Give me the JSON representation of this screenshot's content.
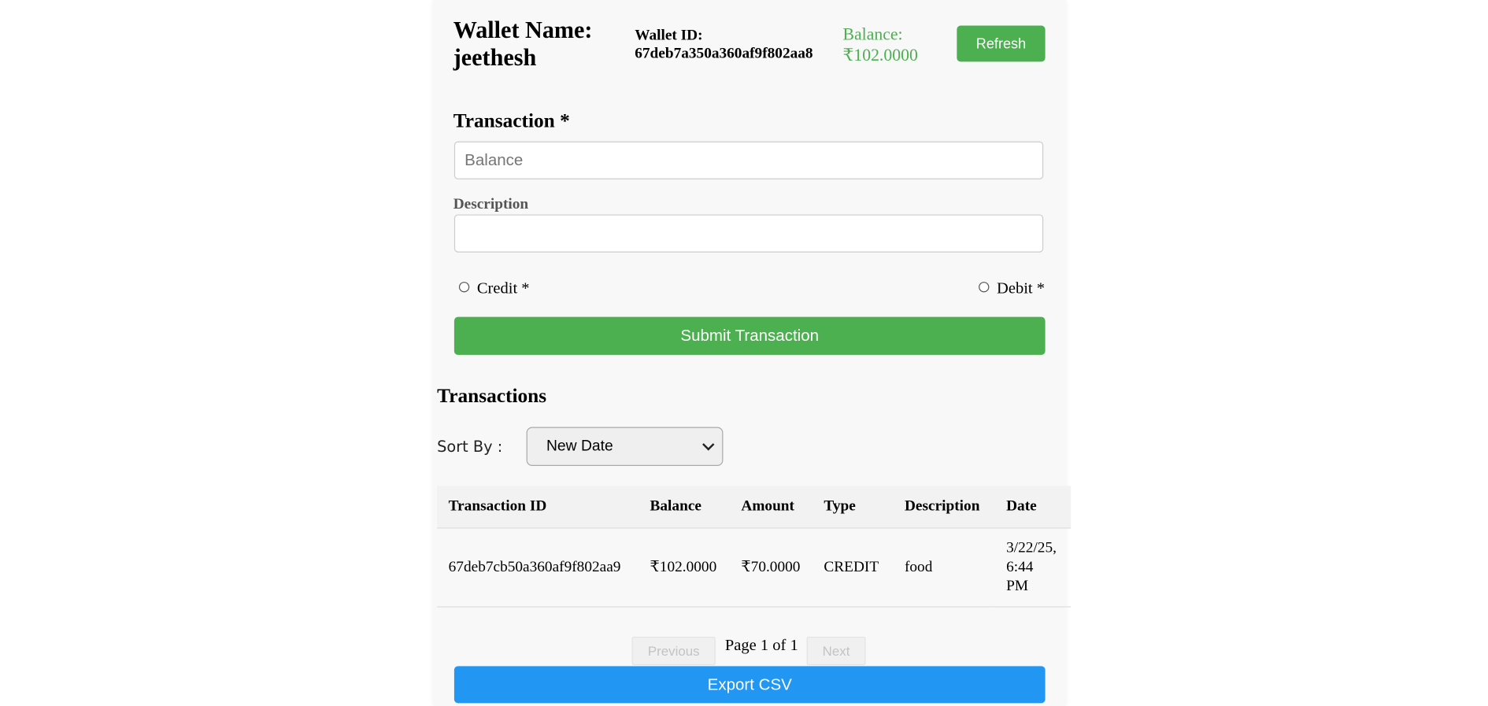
{
  "wallet": {
    "name_line1": "Wallet Name:",
    "name_line2": "jeethesh",
    "id_label": "Wallet ID:",
    "id_value": "67deb7a350a360af9f802aa8",
    "balance_label": "Balance:",
    "balance_value": "₹102.0000",
    "refresh_label": "Refresh"
  },
  "form": {
    "transaction_label": "Transaction *",
    "amount_placeholder": "Balance",
    "description_label": "Description",
    "description_value": "",
    "credit_label": "Credit *",
    "debit_label": "Debit *",
    "submit_label": "Submit Transaction"
  },
  "transactions": {
    "title": "Transactions",
    "sort_label": "Sort By :",
    "sort_selected": "New Date",
    "columns": [
      "Transaction ID",
      "Balance",
      "Amount",
      "Type",
      "Description",
      "Date"
    ],
    "rows": [
      {
        "id": "67deb7cb50a360af9f802aa9",
        "balance": "₹102.0000",
        "amount": "₹70.0000",
        "type": "CREDIT",
        "description": "food",
        "date_line1": "3/22/25,",
        "date_line2": "6:44",
        "date_line3": "PM"
      }
    ]
  },
  "pagination": {
    "previous_label": "Previous",
    "page_info": "Page 1 of 1",
    "next_label": "Next"
  },
  "export_label": "Export CSV",
  "colors": {
    "accent_green": "#4caf50",
    "accent_blue": "#2196f3"
  }
}
